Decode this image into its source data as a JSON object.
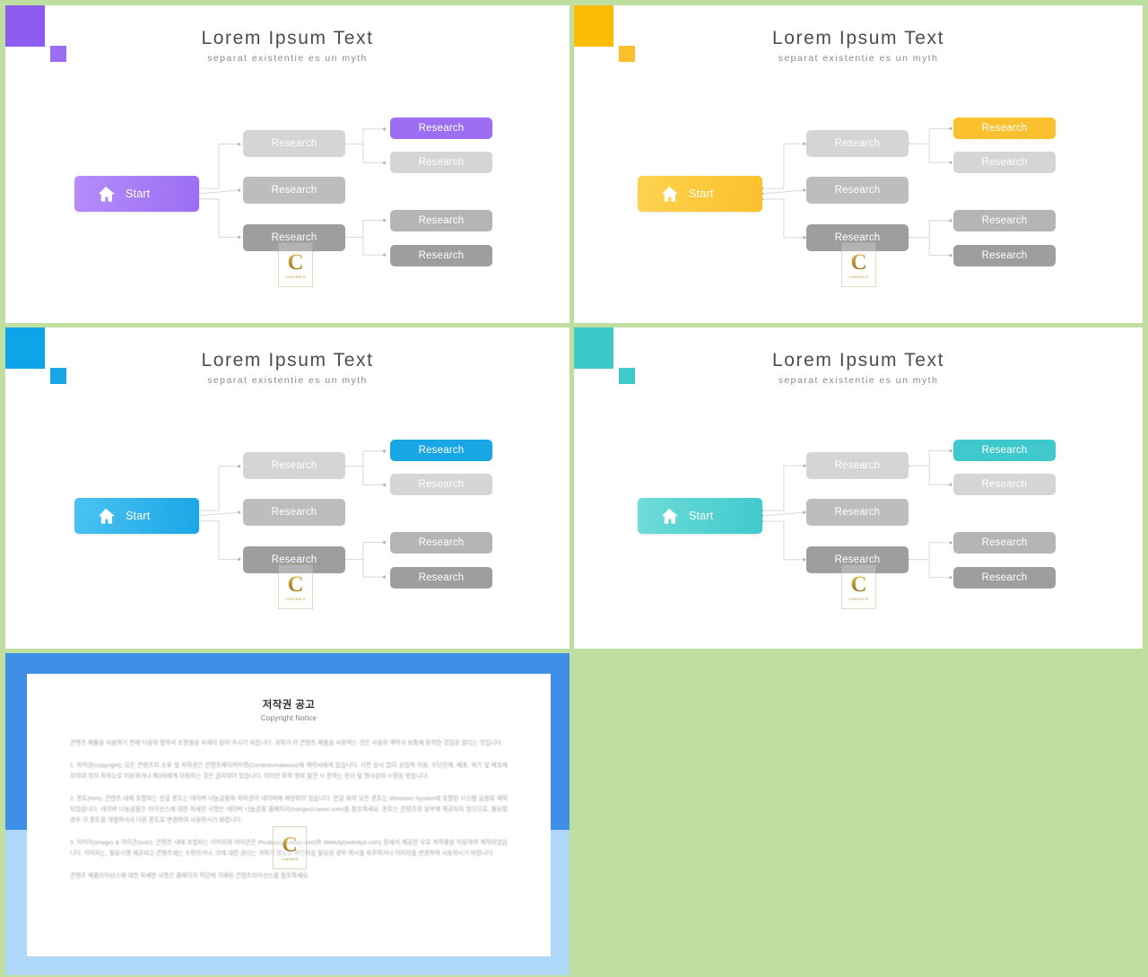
{
  "canvas": {
    "background_color": "#bfdfa0",
    "separator_color": "#bfdfa0"
  },
  "slides": [
    {
      "id": "slide-purple",
      "accent_color": "#9b6ef3",
      "accent_color_light": "#b68dfa",
      "square_large_color": "#8c5cf0",
      "square_small_color": "#9b6ef3",
      "title": "Lorem Ipsum Text",
      "subtitle": "separat existentie es un myth",
      "start_label": "Start",
      "start_icon": "home-icon",
      "nodes": {
        "level2": [
          {
            "label": "Research",
            "color": "#d5d5d5"
          },
          {
            "label": "Research",
            "color": "#bdbdbd"
          },
          {
            "label": "Research",
            "color": "#9e9e9e"
          }
        ],
        "level3": [
          {
            "label": "Research",
            "color": "#9b6ef3",
            "accent": true
          },
          {
            "label": "Research",
            "color": "#d5d5d5",
            "accent": false
          },
          {
            "label": "Research",
            "color": "#b5b5b5",
            "accent": false
          },
          {
            "label": "Research",
            "color": "#9e9e9e",
            "accent": false
          }
        ]
      },
      "watermark": {
        "letter": "C",
        "caption": "CONTENTS"
      }
    },
    {
      "id": "slide-yellow",
      "accent_color": "#fbc02d",
      "accent_color_light": "#fdd34f",
      "square_large_color": "#fbbc04",
      "square_small_color": "#fbc02d",
      "title": "Lorem Ipsum Text",
      "subtitle": "separat existentie es un myth",
      "start_label": "Start",
      "start_icon": "home-icon",
      "nodes": {
        "level2": [
          {
            "label": "Research",
            "color": "#d5d5d5"
          },
          {
            "label": "Research",
            "color": "#bdbdbd"
          },
          {
            "label": "Research",
            "color": "#9e9e9e"
          }
        ],
        "level3": [
          {
            "label": "Research",
            "color": "#fbc02d",
            "accent": true
          },
          {
            "label": "Research",
            "color": "#d5d5d5",
            "accent": false
          },
          {
            "label": "Research",
            "color": "#b5b5b5",
            "accent": false
          },
          {
            "label": "Research",
            "color": "#9e9e9e",
            "accent": false
          }
        ]
      },
      "watermark": {
        "letter": "C",
        "caption": "CONTENTS"
      }
    },
    {
      "id": "slide-blue",
      "accent_color": "#19a6e6",
      "accent_color_light": "#4cc3f2",
      "square_large_color": "#0da5e8",
      "square_small_color": "#19a6e6",
      "title": "Lorem Ipsum Text",
      "subtitle": "separat existentie es un myth",
      "start_label": "Start",
      "start_icon": "home-icon",
      "nodes": {
        "level2": [
          {
            "label": "Research",
            "color": "#d5d5d5"
          },
          {
            "label": "Research",
            "color": "#bdbdbd"
          },
          {
            "label": "Research",
            "color": "#9e9e9e"
          }
        ],
        "level3": [
          {
            "label": "Research",
            "color": "#19a6e6",
            "accent": true
          },
          {
            "label": "Research",
            "color": "#d5d5d5",
            "accent": false
          },
          {
            "label": "Research",
            "color": "#b5b5b5",
            "accent": false
          },
          {
            "label": "Research",
            "color": "#9e9e9e",
            "accent": false
          }
        ]
      },
      "watermark": {
        "letter": "C",
        "caption": "CONTENTS"
      }
    },
    {
      "id": "slide-teal",
      "accent_color": "#3fc9cc",
      "accent_color_light": "#6fdcd8",
      "square_large_color": "#3dc8c8",
      "square_small_color": "#3fc9cc",
      "title": "Lorem Ipsum Text",
      "subtitle": "separat existentie es un myth",
      "start_label": "Start",
      "start_icon": "home-icon",
      "nodes": {
        "level2": [
          {
            "label": "Research",
            "color": "#d5d5d5"
          },
          {
            "label": "Research",
            "color": "#bdbdbd"
          },
          {
            "label": "Research",
            "color": "#9e9e9e"
          }
        ],
        "level3": [
          {
            "label": "Research",
            "color": "#3fc9cc",
            "accent": true
          },
          {
            "label": "Research",
            "color": "#d5d5d5",
            "accent": false
          },
          {
            "label": "Research",
            "color": "#b5b5b5",
            "accent": false
          },
          {
            "label": "Research",
            "color": "#9e9e9e",
            "accent": false
          }
        ]
      },
      "watermark": {
        "letter": "C",
        "caption": "CONTENTS"
      }
    }
  ],
  "copyright_slide": {
    "frame_color_top": "#3f8ee8",
    "frame_color_bottom": "#aed7fa",
    "heading_ko": "저작권 공고",
    "heading_en": "Copyright Notice",
    "paragraphs": [
      "콘텐츠 제품을 사용하기 전에 다음의 협약서 조항들을 자세히 읽어 주시기 바랍니다. 귀하가 이 콘텐츠 제품을 사용하는 것은 사용자 계약서 보증에 동의한 것임을 알리는 것입니다.",
      "1. 저작권(copyright): 모든 콘텐츠의 소유 및 저작권은 콘텐츠메이커마켓(Contentsmakeout)에 계약서에게 있습니다. 사전 승낙 없이 상업적 이용, 무단전재, 배포, 복기 및 배포에 의하여 영리 목적으로 이용하거나 제3자에게 이용하는 것은 금지되어 있습니다. 이러한 목적 행위 발견 시 준하는 민사 및 형사상의 시정을 받습니다.",
      "2. 폰트(font): 콘텐츠 내에 포함되는 한글 폰트는 네이버 나눔글꼴의 저작권이 네이버에 제한되어 있습니다. 한글 외의 모든 폰트는 Windows System에 포함된 시스템 글꼴로 제작되었습니다. 네이버 나눔글꼴은 라이선스에 대한 자세한 사항은 네이버 나눔글꼴 홈페이지(hangeul.naver.com)를 참조하세요. 폰트는 콘텐츠의 일부에 제공되지 않으므로, 필요할 경우 각 폰트를 개별하셔서 다른 폰트로 변경하여 사용하시기 바랍니다.",
      "3. 이미지(image) & 아이콘(icon): 콘텐츠 내에 포함되는 이미지와 아이콘은 Pixabay(pixabay.com)와 Weboly(webolyb.com) 등에서 제공한 무료 저작물을 이용하여 제작되었습니다. 이미지는, 필요시엔 제공되고 콘텐츠에는 수정하거나, 이에 대한 권리는 귀하가 별도로 확인하실 필요성 경우 여시를 위주하거나 이미지를 변경하여 사용하시기 바랍니다.",
      "콘텐츠 제품라이선스에 대한 자세한 사항은 홈페이지 하단에 기재된 콘텐츠라이선스를 참조하세요."
    ],
    "watermark": {
      "letter": "C",
      "caption": "CONTENTS"
    }
  }
}
